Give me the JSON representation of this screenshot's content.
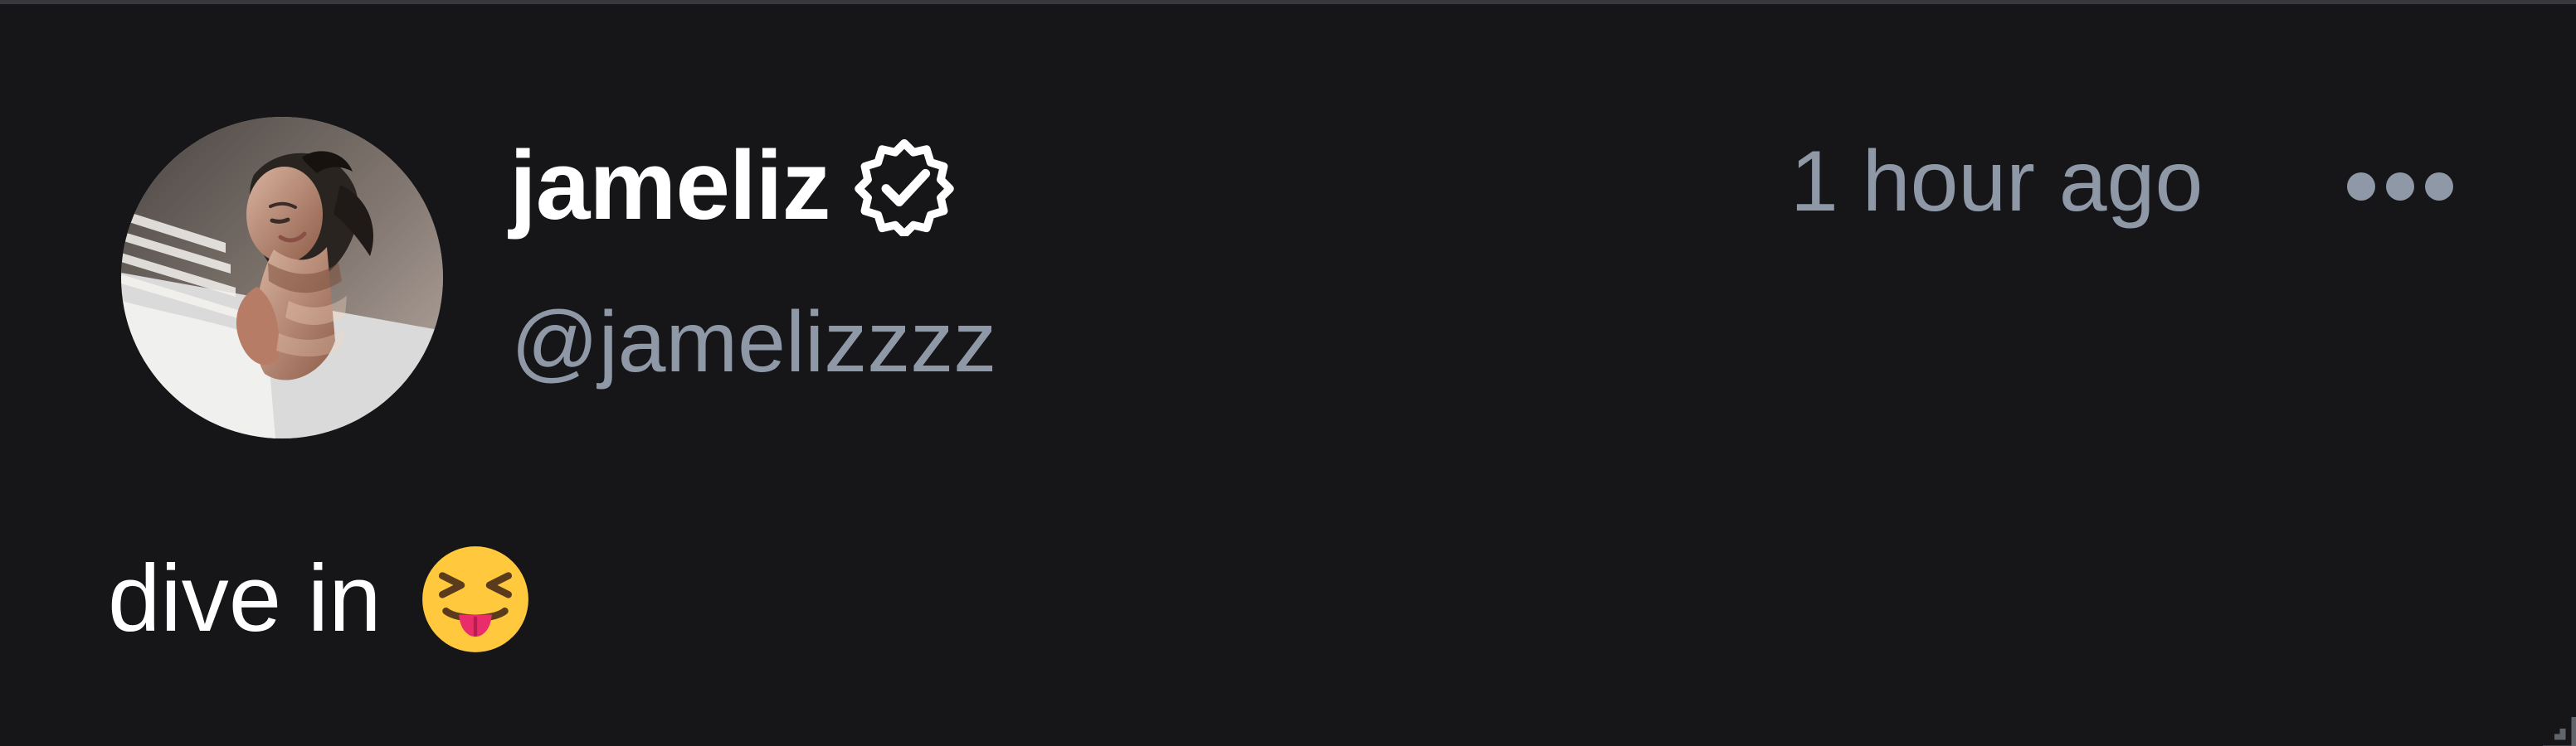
{
  "post": {
    "author": {
      "display_name": "jameliz",
      "handle": "@jamelizzzz",
      "verified": true,
      "avatar_icon": "profile-photo"
    },
    "timestamp": "1 hour ago",
    "text": "dive in",
    "emoji": {
      "name": "squinting-face-with-tongue",
      "glyph": "😝"
    },
    "actions": {
      "more_icon": "more-horizontal-icon"
    }
  },
  "colors": {
    "background": "#161619",
    "top_divider": "#38383d",
    "primary_text": "#ffffff",
    "secondary_text": "#8f98a6"
  }
}
